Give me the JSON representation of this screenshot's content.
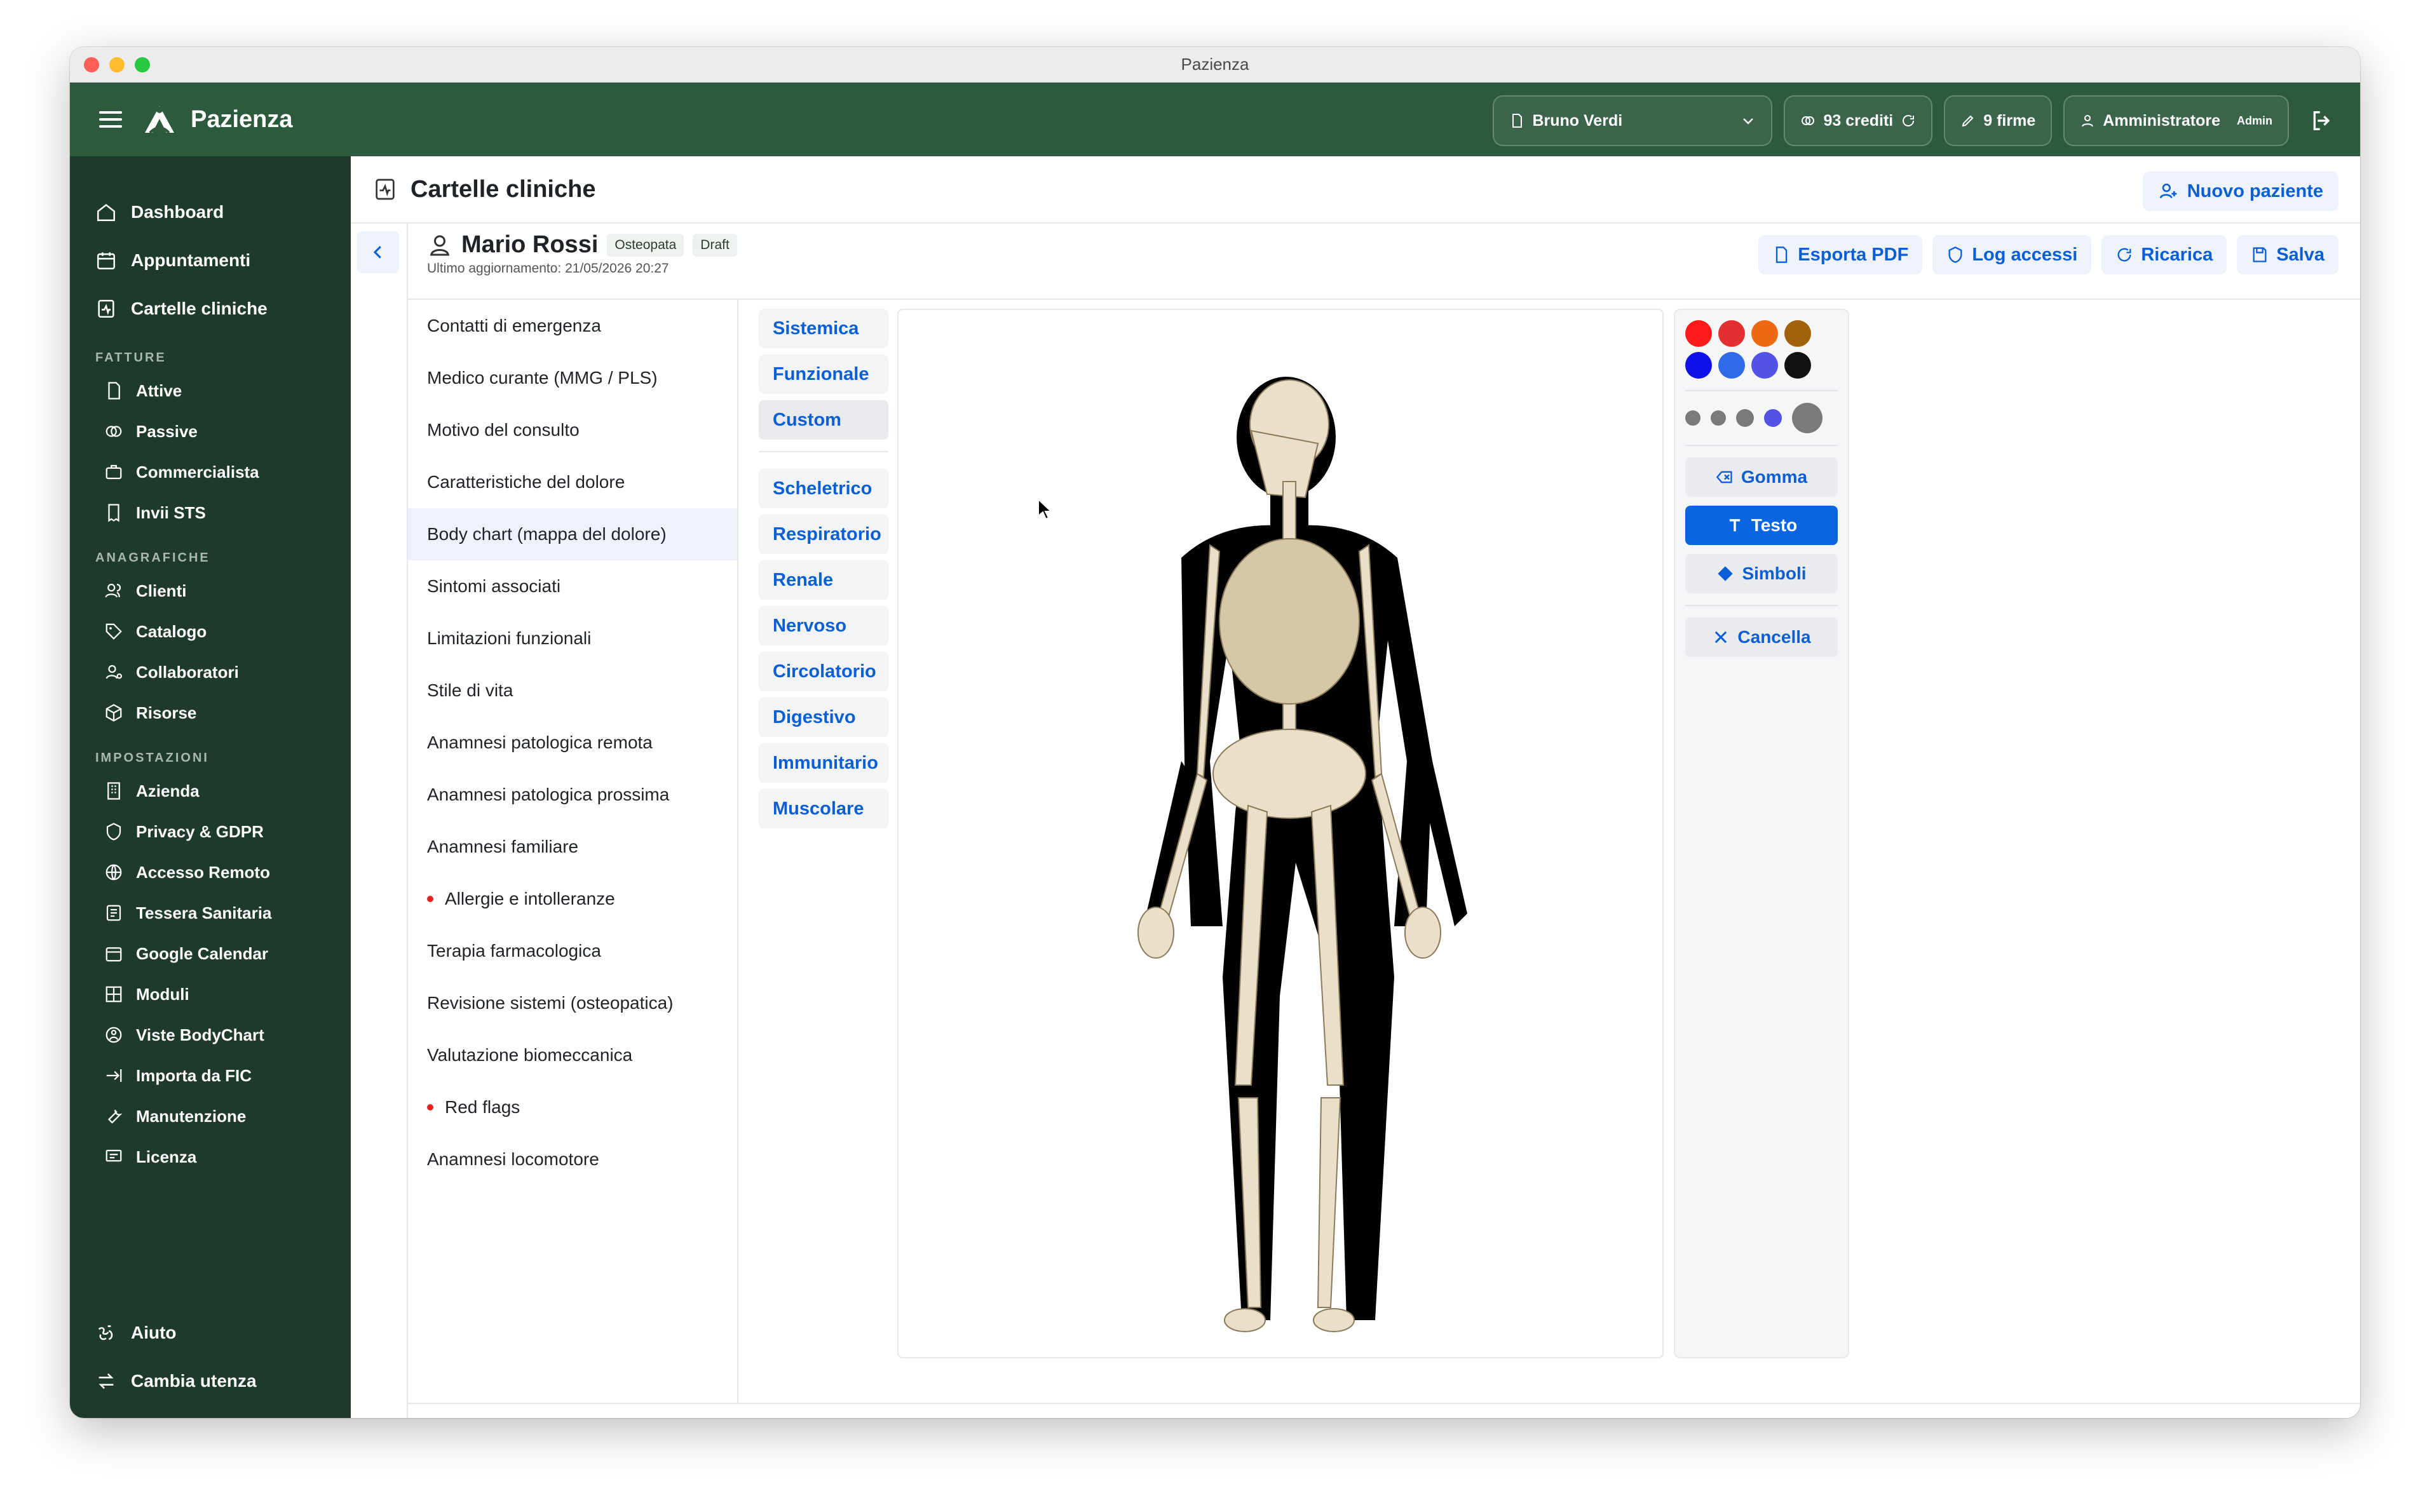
{
  "window": {
    "title": "Pazienza"
  },
  "topbar": {
    "brand": "Pazienza",
    "patient_select": "Bruno Verdi",
    "credits": "93 crediti",
    "signatures": "9 firme",
    "user": "Amministratore",
    "role_badge": "Admin"
  },
  "sidebar": {
    "main": [
      {
        "label": "Dashboard",
        "icon": "home-icon"
      },
      {
        "label": "Appuntamenti",
        "icon": "calendar-icon"
      },
      {
        "label": "Cartelle cliniche",
        "icon": "clinical-record-icon"
      }
    ],
    "sections": [
      {
        "title": "FATTURE",
        "items": [
          "Attive",
          "Passive",
          "Commercialista",
          "Invii STS"
        ]
      },
      {
        "title": "ANAGRAFICHE",
        "items": [
          "Clienti",
          "Catalogo",
          "Collaboratori",
          "Risorse"
        ]
      },
      {
        "title": "IMPOSTAZIONI",
        "items": [
          "Azienda",
          "Privacy & GDPR",
          "Accesso Remoto",
          "Tessera Sanitaria",
          "Google Calendar",
          "Moduli",
          "Viste BodyChart",
          "Importa da FIC",
          "Manutenzione",
          "Licenza"
        ]
      }
    ],
    "bottom": {
      "help": "Aiuto",
      "switch_user": "Cambia utenza"
    }
  },
  "page": {
    "title": "Cartelle cliniche",
    "new_patient": "Nuovo paziente"
  },
  "patient": {
    "name": "Mario Rossi",
    "tag_role": "Osteopata",
    "tag_status": "Draft",
    "updated": "Ultimo aggiornamento: 21/05/2026 20:27"
  },
  "actions": {
    "export": "Esporta PDF",
    "log": "Log accessi",
    "reload": "Ricarica",
    "save": "Salva"
  },
  "record_sections": [
    {
      "label": "Contatti di emergenza",
      "flag": false
    },
    {
      "label": "Medico curante (MMG / PLS)",
      "flag": false
    },
    {
      "label": "Motivo del consulto",
      "flag": false
    },
    {
      "label": "Caratteristiche del dolore",
      "flag": false
    },
    {
      "label": "Body chart (mappa del dolore)",
      "flag": false,
      "active": true
    },
    {
      "label": "Sintomi associati",
      "flag": false
    },
    {
      "label": "Limitazioni funzionali",
      "flag": false
    },
    {
      "label": "Stile di vita",
      "flag": false
    },
    {
      "label": "Anamnesi patologica remota",
      "flag": false
    },
    {
      "label": "Anamnesi patologica prossima",
      "flag": false
    },
    {
      "label": "Anamnesi familiare",
      "flag": false
    },
    {
      "label": "Allergie e intolleranze",
      "flag": true
    },
    {
      "label": "Terapia farmacologica",
      "flag": false
    },
    {
      "label": "Revisione sistemi (osteopatica)",
      "flag": false
    },
    {
      "label": "Valutazione biomeccanica",
      "flag": false
    },
    {
      "label": "Red flags",
      "flag": true
    },
    {
      "label": "Anamnesi locomotore",
      "flag": false
    }
  ],
  "views": {
    "group1": [
      "Sistemica",
      "Funzionale",
      "Custom"
    ],
    "group2": [
      "Scheletrico",
      "Respiratorio",
      "Renale",
      "Nervoso",
      "Circolatorio",
      "Digestivo",
      "Immunitario",
      "Muscolare"
    ]
  },
  "tools": {
    "colors": [
      "#ff1a1a",
      "#e23030",
      "#ee6a12",
      "#a0620a",
      "#1010e8",
      "#2f6ae8",
      "#5252e6",
      "#111111"
    ],
    "eraser": "Gomma",
    "text": "Testo",
    "symbols": "Simboli",
    "clear": "Cancella"
  }
}
